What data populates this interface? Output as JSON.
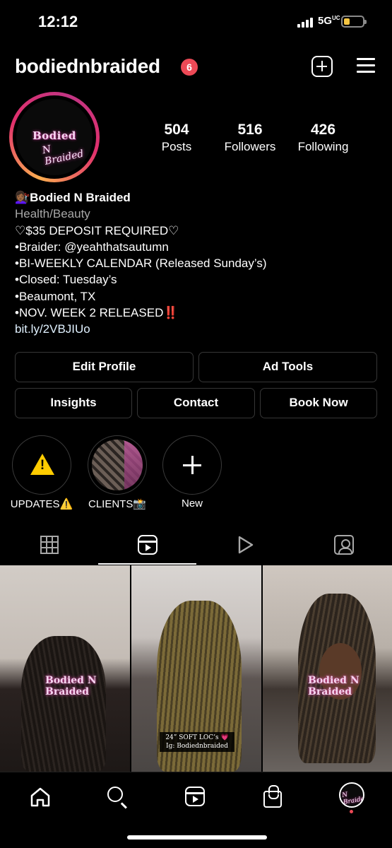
{
  "status_bar": {
    "time": "12:12",
    "network": "5G",
    "network_suffix": "UC"
  },
  "header": {
    "username": "bodiednbraided",
    "notification_count": "6"
  },
  "profile": {
    "avatar_logo_top": "Bodied",
    "avatar_logo_bottom": "N Braided",
    "stats": [
      {
        "value": "504",
        "label": "Posts"
      },
      {
        "value": "516",
        "label": "Followers"
      },
      {
        "value": "426",
        "label": "Following"
      }
    ],
    "bio": {
      "name": "💇🏾‍♀️Bodied N Braided",
      "category": "Health/Beauty",
      "lines": [
        "♡$35 DEPOSIT REQUIRED♡",
        "•Braider: @yeahthatsautumn",
        "•BI-WEEKLY CALENDAR (Released Sunday’s)",
        "•Closed: Tuesday’s",
        "•Beaumont, TX",
        "•NOV. WEEK 2 RELEASED‼️"
      ],
      "link": "bit.ly/2VBJIUo"
    }
  },
  "buttons": {
    "edit_profile": "Edit Profile",
    "ad_tools": "Ad Tools",
    "insights": "Insights",
    "contact": "Contact",
    "book_now": "Book Now"
  },
  "highlights": [
    {
      "label": "UPDATES⚠️",
      "icon": "warning-icon"
    },
    {
      "label": "CLIENTS📸",
      "icon": "braids-photo"
    },
    {
      "label": "New",
      "icon": "plus-icon"
    }
  ],
  "tabs": [
    {
      "name": "grid",
      "icon": "grid-icon",
      "active": false
    },
    {
      "name": "reels",
      "icon": "reels-icon",
      "active": true
    },
    {
      "name": "videos",
      "icon": "play-icon",
      "active": false
    },
    {
      "name": "tagged",
      "icon": "tagged-icon",
      "active": false
    }
  ],
  "posts": [
    {
      "overlay": "Bodied N Braided"
    },
    {
      "caption_line1": "24” SOFT LOC’s 💗",
      "caption_line2": "Ig: Bodiednbraided"
    },
    {
      "overlay": "Bodied N Braided"
    }
  ],
  "bottom_nav": [
    "home-icon",
    "search-icon",
    "reels-icon",
    "shop-icon",
    "profile-avatar"
  ],
  "colors": {
    "background": "#000000",
    "badge": "#ed4956",
    "secondary_text": "#a8a8a8",
    "link": "#e0f1ff",
    "button_border": "#363636",
    "warning": "#ffcc00"
  }
}
